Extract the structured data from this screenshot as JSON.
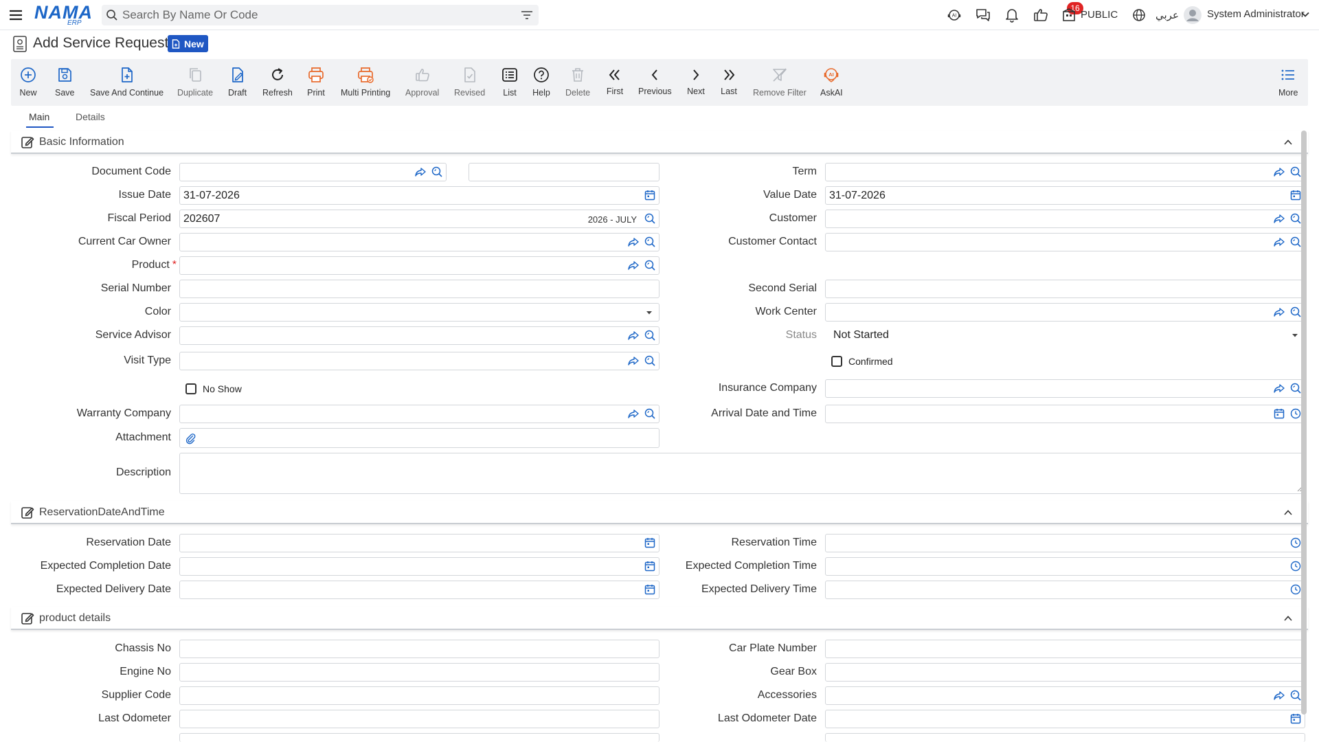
{
  "header": {
    "logo_text": "NAMA",
    "logo_sub": "ERP",
    "search_placeholder": "Search By Name Or Code",
    "notification_count": "16",
    "branch": "PUBLIC",
    "language": "عربي",
    "user_name": "System Administrator"
  },
  "page": {
    "title": "Add Service Request",
    "mode_badge": "New"
  },
  "toolbar": {
    "new": "New",
    "save": "Save",
    "save_continue": "Save And Continue",
    "duplicate": "Duplicate",
    "draft": "Draft",
    "refresh": "Refresh",
    "print": "Print",
    "multi_printing": "Multi Printing",
    "approval": "Approval",
    "revised": "Revised",
    "list": "List",
    "help": "Help",
    "delete": "Delete",
    "first": "First",
    "previous": "Previous",
    "next": "Next",
    "last": "Last",
    "remove_filter": "Remove Filter",
    "askai": "AskAI",
    "more": "More"
  },
  "tabs": [
    "Main",
    "Details"
  ],
  "basic": {
    "title": "Basic Information",
    "document_code": "Document Code",
    "issue_date": "Issue Date",
    "issue_date_value": "31-07-2026",
    "fiscal_period": "Fiscal Period",
    "fiscal_period_value": "202607",
    "fiscal_period_hint": "2026 - JULY",
    "current_car_owner": "Current Car Owner",
    "product": "Product",
    "required_mark": "*",
    "serial_number": "Serial Number",
    "color": "Color",
    "service_advisor": "Service Advisor",
    "visit_type": "Visit Type",
    "no_show": "No Show",
    "warranty_company": "Warranty Company",
    "attachment": "Attachment",
    "description": "Description",
    "term": "Term",
    "value_date": "Value Date",
    "value_date_value": "31-07-2026",
    "customer": "Customer",
    "customer_contact": "Customer Contact",
    "second_serial": "Second Serial",
    "work_center": "Work Center",
    "status": "Status",
    "status_value": "Not Started",
    "confirmed": "Confirmed",
    "insurance_company": "Insurance Company",
    "arrival_date_time": "Arrival Date and Time"
  },
  "reservation": {
    "title": "ReservationDateAndTime",
    "reservation_date": "Reservation Date",
    "expected_completion_date": "Expected Completion Date",
    "expected_delivery_date": "Expected Delivery Date",
    "reservation_time": "Reservation Time",
    "expected_completion_time": "Expected Completion Time",
    "expected_delivery_time": "Expected Delivery Time"
  },
  "product_details": {
    "title": "product details",
    "chassis_no": "Chassis No",
    "engine_no": "Engine No",
    "supplier_code": "Supplier Code",
    "last_odometer": "Last Odometer",
    "car_plate_number": "Car Plate Number",
    "gear_box": "Gear Box",
    "accessories": "Accessories",
    "last_odometer_date": "Last Odometer Date"
  },
  "colors": {
    "primary": "#1f57c3",
    "link_icon": "#1c66c7",
    "print_orange": "#e8692a",
    "badge_red": "#e02424"
  }
}
